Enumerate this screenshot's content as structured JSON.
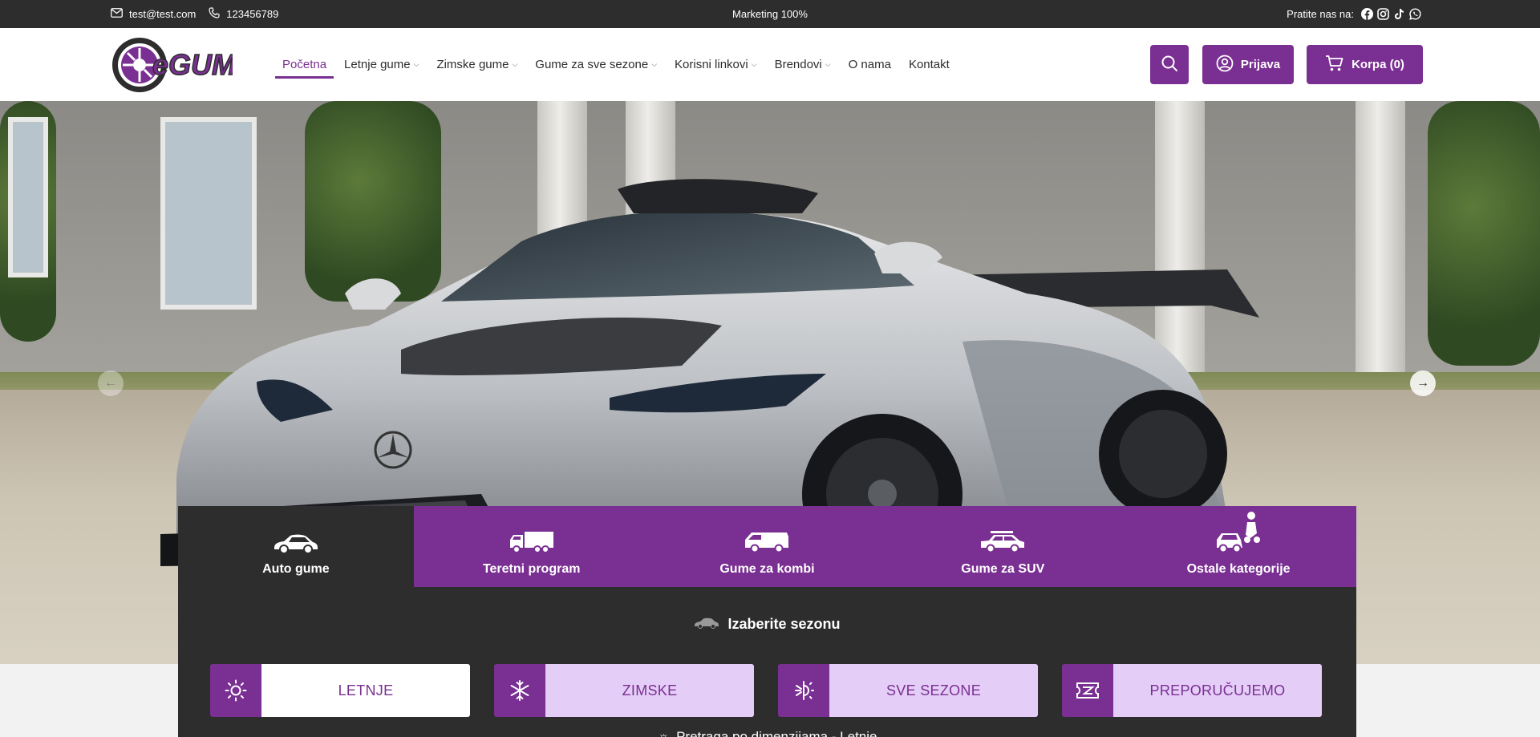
{
  "topbar": {
    "email": "test@test.com",
    "phone": "123456789",
    "center_text": "Marketing 100%",
    "follow_label": "Pratite nas na:",
    "social_icons": [
      "facebook-icon",
      "instagram-icon",
      "tiktok-icon",
      "whatsapp-icon"
    ]
  },
  "header": {
    "logo_text": "eGUME",
    "nav": [
      {
        "label": "Početna",
        "dropdown": false,
        "active": true
      },
      {
        "label": "Letnje gume",
        "dropdown": true
      },
      {
        "label": "Zimske gume",
        "dropdown": true
      },
      {
        "label": "Gume za sve sezone",
        "dropdown": true
      },
      {
        "label": "Korisni linkovi",
        "dropdown": true
      },
      {
        "label": "Brendovi",
        "dropdown": true
      },
      {
        "label": "O nama",
        "dropdown": false
      },
      {
        "label": "Kontakt",
        "dropdown": false
      }
    ],
    "login_label": "Prijava",
    "cart_label": "Korpa (0)"
  },
  "colors": {
    "brand": "#7a2f92",
    "dark": "#2d2d2d",
    "light_purple": "#e4cdf6"
  },
  "tabs": [
    {
      "label": "Auto gume",
      "icon": "car-icon",
      "active": true
    },
    {
      "label": "Teretni program",
      "icon": "truck-icon",
      "active": false
    },
    {
      "label": "Gume za kombi",
      "icon": "van-icon",
      "active": false
    },
    {
      "label": "Gume za SUV",
      "icon": "suv-icon",
      "active": false
    },
    {
      "label": "Ostale kategorije",
      "icon": "other-vehicles-icon",
      "active": false
    }
  ],
  "season_selector": {
    "title": "Izaberite sezonu",
    "options": [
      {
        "label": "LETNJE",
        "icon": "sun-icon",
        "active": true
      },
      {
        "label": "ZIMSKE",
        "icon": "snowflake-icon",
        "active": false
      },
      {
        "label": "SVE SEZONE",
        "icon": "all-season-icon",
        "active": false
      },
      {
        "label": "PREPORUČUJEMO",
        "icon": "ticket-icon",
        "active": false
      }
    ],
    "subtitle": "Pretraga po dimenzijama - Letnje"
  }
}
